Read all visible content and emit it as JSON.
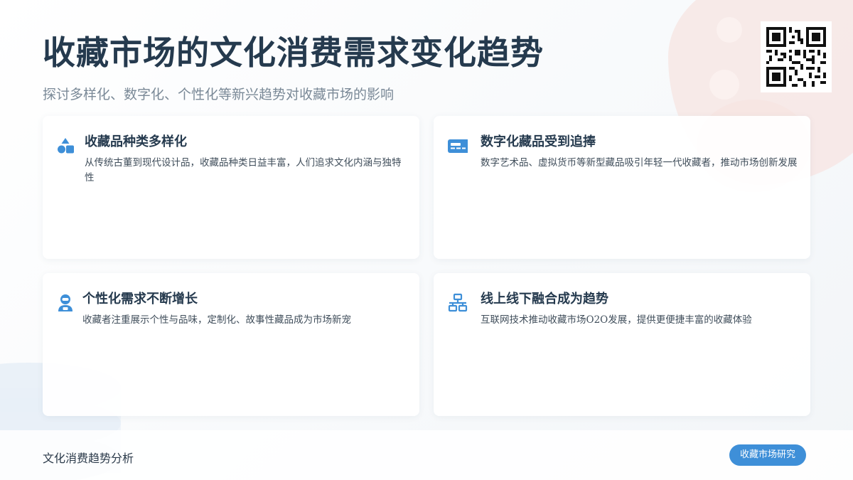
{
  "header": {
    "title": "收藏市场的文化消费需求变化趋势",
    "subtitle": "探讨多样化、数字化、个性化等新兴趋势对收藏市场的影响"
  },
  "colors": {
    "accent": "#3e8fd8",
    "title": "#253a4e",
    "decor_pink": "#f7e4e1",
    "decor_blue": "#e8f0f7"
  },
  "cards": [
    {
      "icon": "shapes-icon",
      "title": "收藏品种类多样化",
      "desc": "从传统古董到现代设计品，收藏品种类日益丰富，人们追求文化内涵与独特性"
    },
    {
      "icon": "id-card-icon",
      "title": "数字化藏品受到追捧",
      "desc": "数字艺术品、虚拟货币等新型藏品吸引年轻一代收藏者，推动市场创新发展"
    },
    {
      "icon": "robot-icon",
      "title": "个性化需求不断增长",
      "desc": "收藏者注重展示个性与品味，定制化、故事性藏品成为市场新宠"
    },
    {
      "icon": "network-icon",
      "title": "线上线下融合成为趋势",
      "desc": "互联网技术推动收藏市场O2O发展，提供更便捷丰富的收藏体验"
    }
  ],
  "footer": {
    "left_text": "文化消费趋势分析",
    "badge": "收藏市场研究"
  },
  "qr_code": {
    "icon": "qr-code-icon"
  }
}
